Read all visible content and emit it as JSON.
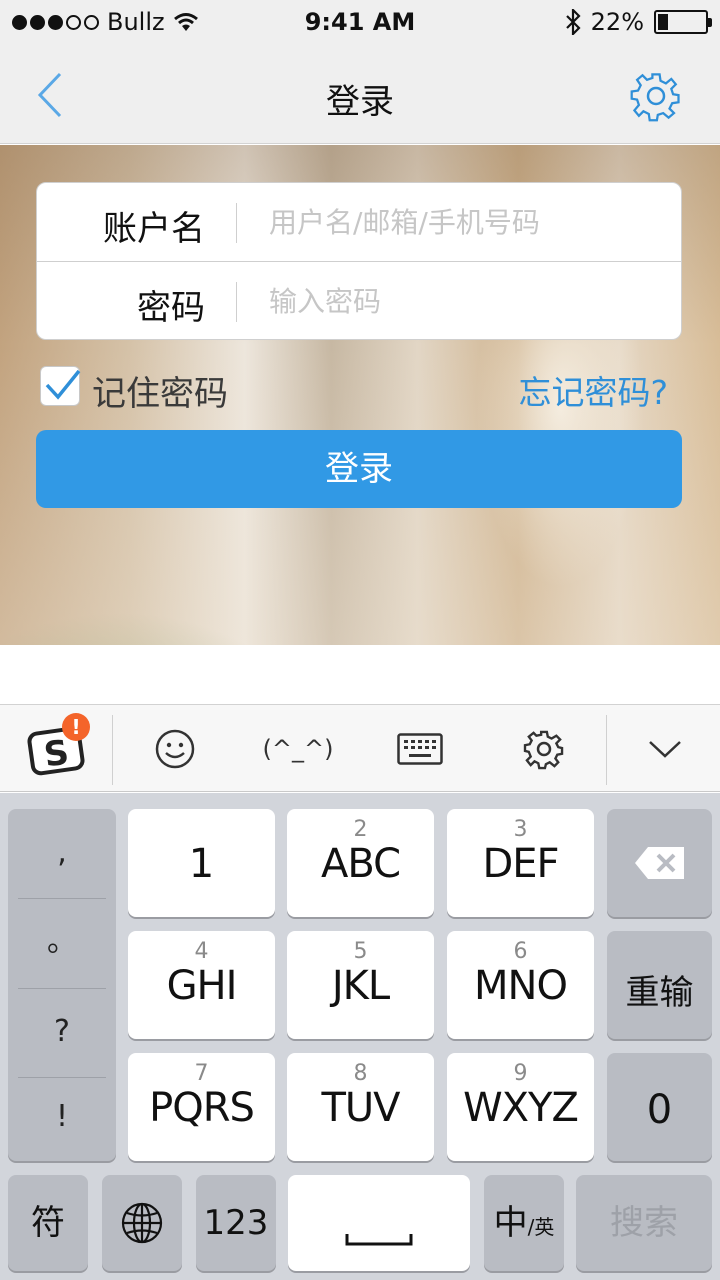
{
  "status_bar": {
    "carrier": "Bullz",
    "time": "9:41 AM",
    "battery_percent": "22%",
    "battery_level": 0.22,
    "signal_bars_filled": 3,
    "signal_bars_total": 5
  },
  "nav": {
    "title": "登录",
    "back_icon": "chevron-left-icon",
    "settings_icon": "gear-icon"
  },
  "login_form": {
    "username_label": "账户名",
    "username_placeholder": "用户名/邮箱/手机号码",
    "username_value": "",
    "password_label": "密码",
    "password_placeholder": "输入密码",
    "password_value": "",
    "remember_checked": true,
    "remember_label": "记住密码",
    "forgot_label": "忘记密码?",
    "submit_label": "登录"
  },
  "keyboard_toolbar": {
    "items": [
      "sogou-logo-icon",
      "emoji-icon",
      "kaomoji",
      "keyboard-icon",
      "gear-icon",
      "chevron-down-icon"
    ],
    "kaomoji_text": "(^_^)",
    "badge": "!"
  },
  "keyboard": {
    "punctuation": [
      ",",
      "。",
      "?",
      "!"
    ],
    "keys": [
      {
        "num": "",
        "label": "1"
      },
      {
        "num": "2",
        "label": "ABC"
      },
      {
        "num": "3",
        "label": "DEF"
      },
      {
        "num": "4",
        "label": "GHI"
      },
      {
        "num": "5",
        "label": "JKL"
      },
      {
        "num": "6",
        "label": "MNO"
      },
      {
        "num": "7",
        "label": "PQRS"
      },
      {
        "num": "8",
        "label": "TUV"
      },
      {
        "num": "9",
        "label": "WXYZ"
      }
    ],
    "reinput_label": "重输",
    "zero_label": "0",
    "symbol_label": "符",
    "numbers_label": "123",
    "lang_main": "中",
    "lang_sub": "/英",
    "search_label": "搜索"
  },
  "colors": {
    "accent": "#3199e5",
    "link": "#2f8fd8",
    "badge": "#f4642a"
  }
}
